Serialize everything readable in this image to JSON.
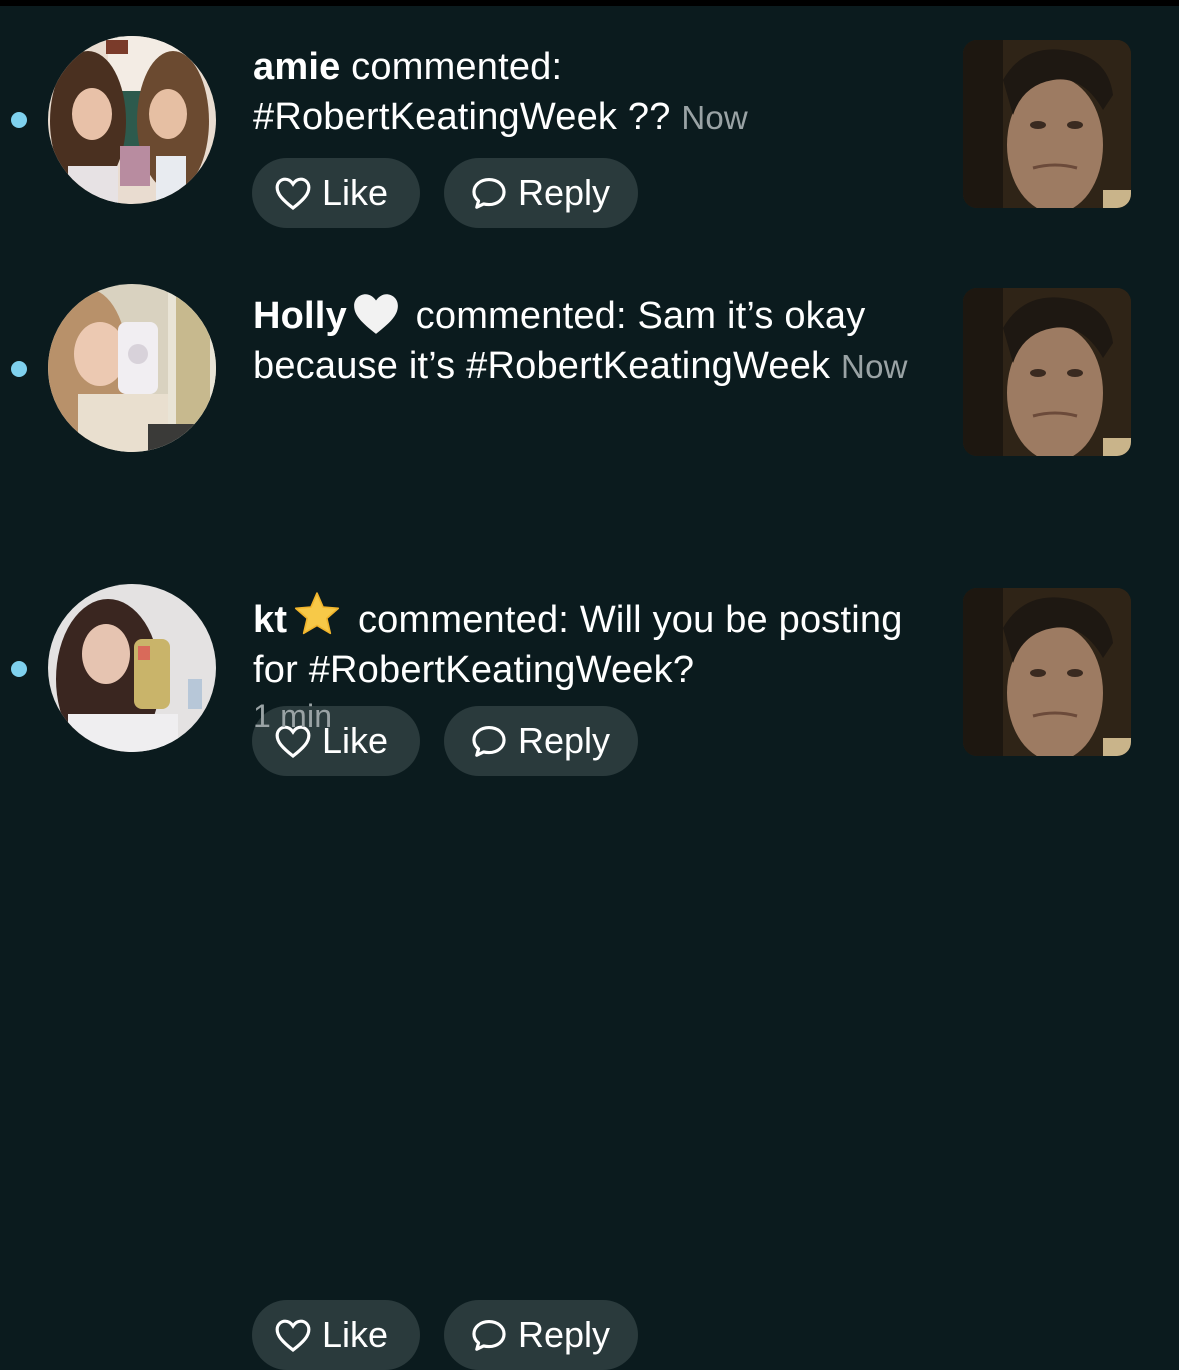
{
  "notifications": [
    {
      "username": "amie",
      "action_text": " commented: ",
      "comment_text": "#RobertKeatingWeek ??",
      "time": "Now",
      "like_label": "Like",
      "reply_label": "Reply",
      "avatar": "two-girls-photo",
      "thumbnail": "man-face-photo"
    },
    {
      "username": "Holly",
      "username_emoji": "white-heart",
      "action_text": " commented: ",
      "comment_text": "Sam it’s okay because it’s #RobertKeatingWeek",
      "time": "Now",
      "like_label": "Like",
      "reply_label": "Reply",
      "avatar": "girl-mirror-selfie-photo",
      "thumbnail": "man-face-photo"
    },
    {
      "username": "kt",
      "username_emoji": "star",
      "action_text": " commented: ",
      "comment_text": "Will you be posting for #RobertKeatingWeek?",
      "time": "1 min",
      "like_label": "Like",
      "reply_label": "Reply",
      "avatar": "girl-phone-selfie-photo",
      "thumbnail": "man-face-photo"
    }
  ],
  "colors": {
    "background": "#0b1b1e",
    "button": "#2a3a3c",
    "unread_dot": "#7fd1ee",
    "timestamp": "#9aa3a5"
  },
  "icons": {
    "like": "heart-outline-icon",
    "reply": "speech-bubble-icon"
  }
}
